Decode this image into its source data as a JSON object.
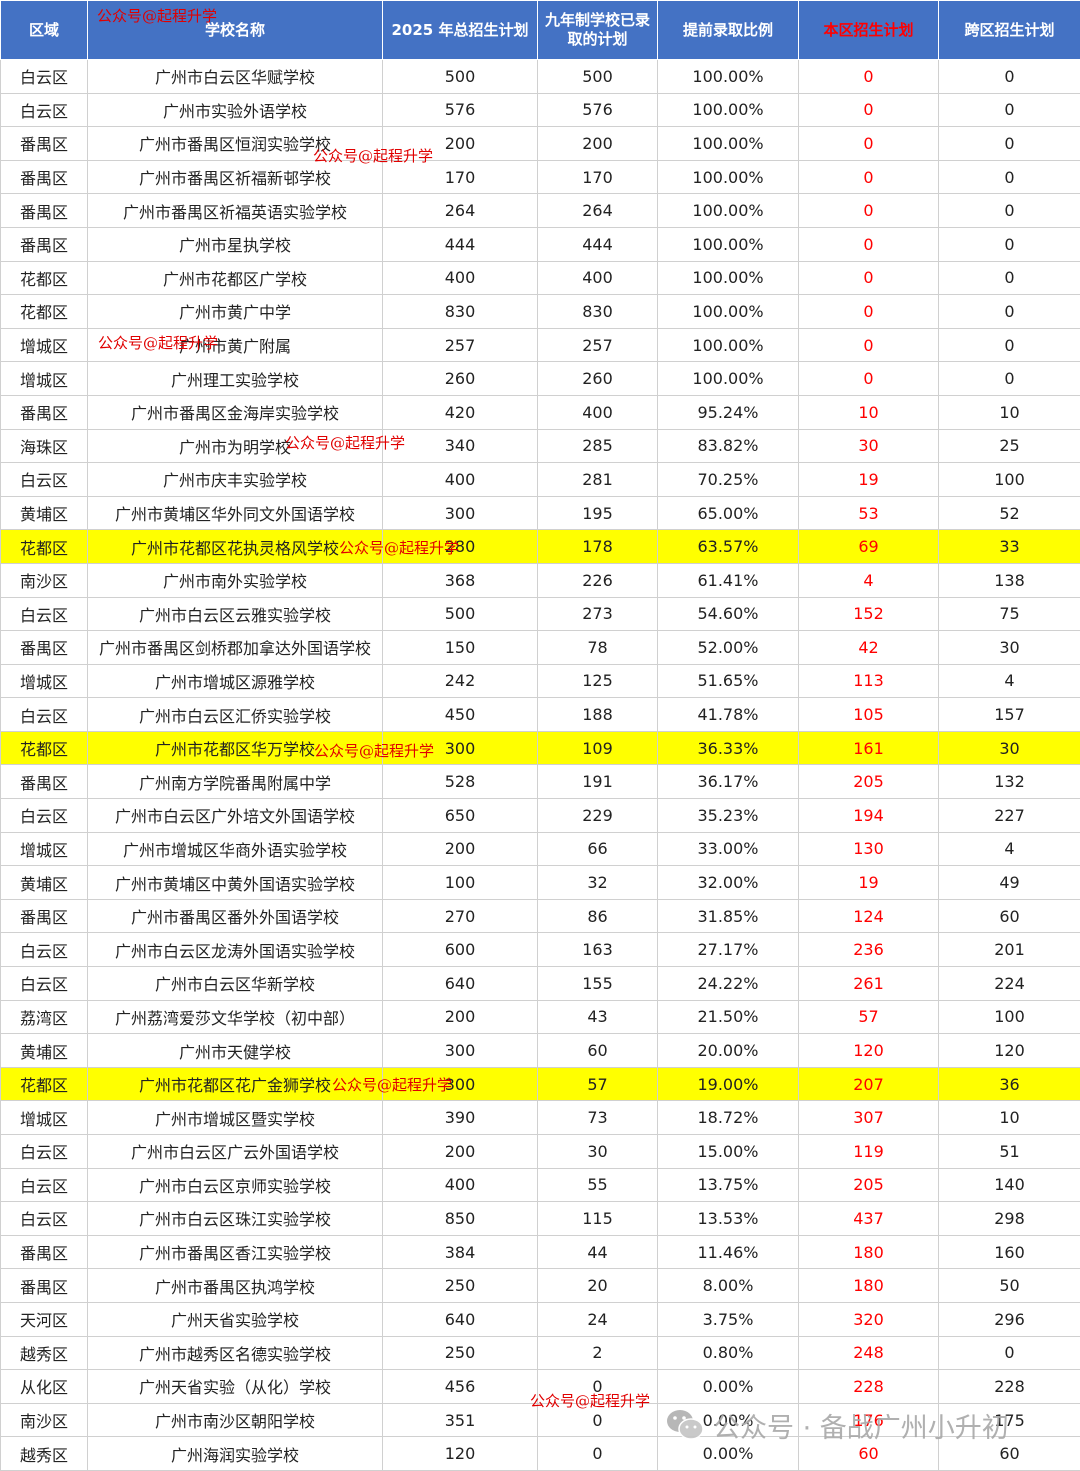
{
  "table": {
    "headers": [
      "区域",
      "学校名称",
      "2025 年总招生计划",
      "九年制学校已录取的计划",
      "提前录取比例",
      "本区招生计划",
      "跨区招生计划"
    ],
    "rows": [
      [
        "白云区",
        "广州市白云区华赋学校",
        "500",
        "500",
        "100.00%",
        "0",
        "0"
      ],
      [
        "白云区",
        "广州市实验外语学校",
        "576",
        "576",
        "100.00%",
        "0",
        "0"
      ],
      [
        "番禺区",
        "广州市番禺区恒润实验学校",
        "200",
        "200",
        "100.00%",
        "0",
        "0"
      ],
      [
        "番禺区",
        "广州市番禺区祈福新邨学校",
        "170",
        "170",
        "100.00%",
        "0",
        "0"
      ],
      [
        "番禺区",
        "广州市番禺区祈福英语实验学校",
        "264",
        "264",
        "100.00%",
        "0",
        "0"
      ],
      [
        "番禺区",
        "广州市星执学校",
        "444",
        "444",
        "100.00%",
        "0",
        "0"
      ],
      [
        "花都区",
        "广州市花都区广学校",
        "400",
        "400",
        "100.00%",
        "0",
        "0"
      ],
      [
        "花都区",
        "广州市黄广中学",
        "830",
        "830",
        "100.00%",
        "0",
        "0"
      ],
      [
        "增城区",
        "广州市黄广附属",
        "257",
        "257",
        "100.00%",
        "0",
        "0"
      ],
      [
        "增城区",
        "广州理工实验学校",
        "260",
        "260",
        "100.00%",
        "0",
        "0"
      ],
      [
        "番禺区",
        "广州市番禺区金海岸实验学校",
        "420",
        "400",
        "95.24%",
        "10",
        "10"
      ],
      [
        "海珠区",
        "广州市为明学校",
        "340",
        "285",
        "83.82%",
        "30",
        "25"
      ],
      [
        "白云区",
        "广州市庆丰实验学校",
        "400",
        "281",
        "70.25%",
        "19",
        "100"
      ],
      [
        "黄埔区",
        "广州市黄埔区华外同文外国语学校",
        "300",
        "195",
        "65.00%",
        "53",
        "52"
      ],
      [
        "花都区",
        "广州市花都区花执灵格风学校",
        "280",
        "178",
        "63.57%",
        "69",
        "33"
      ],
      [
        "南沙区",
        "广州市南外实验学校",
        "368",
        "226",
        "61.41%",
        "4",
        "138"
      ],
      [
        "白云区",
        "广州市白云区云雅实验学校",
        "500",
        "273",
        "54.60%",
        "152",
        "75"
      ],
      [
        "番禺区",
        "广州市番禺区剑桥郡加拿达外国语学校",
        "150",
        "78",
        "52.00%",
        "42",
        "30"
      ],
      [
        "增城区",
        "广州市增城区源雅学校",
        "242",
        "125",
        "51.65%",
        "113",
        "4"
      ],
      [
        "白云区",
        "广州市白云区汇侨实验学校",
        "450",
        "188",
        "41.78%",
        "105",
        "157"
      ],
      [
        "花都区",
        "广州市花都区华万学校",
        "300",
        "109",
        "36.33%",
        "161",
        "30"
      ],
      [
        "番禺区",
        "广州南方学院番禺附属中学",
        "528",
        "191",
        "36.17%",
        "205",
        "132"
      ],
      [
        "白云区",
        "广州市白云区广外培文外国语学校",
        "650",
        "229",
        "35.23%",
        "194",
        "227"
      ],
      [
        "增城区",
        "广州市增城区华商外语实验学校",
        "200",
        "66",
        "33.00%",
        "130",
        "4"
      ],
      [
        "黄埔区",
        "广州市黄埔区中黄外国语实验学校",
        "100",
        "32",
        "32.00%",
        "19",
        "49"
      ],
      [
        "番禺区",
        "广州市番禺区番外外国语学校",
        "270",
        "86",
        "31.85%",
        "124",
        "60"
      ],
      [
        "白云区",
        "广州市白云区龙涛外国语实验学校",
        "600",
        "163",
        "27.17%",
        "236",
        "201"
      ],
      [
        "白云区",
        "广州市白云区华新学校",
        "640",
        "155",
        "24.22%",
        "261",
        "224"
      ],
      [
        "荔湾区",
        "广州荔湾爱莎文华学校（初中部）",
        "200",
        "43",
        "21.50%",
        "57",
        "100"
      ],
      [
        "黄埔区",
        "广州市天健学校",
        "300",
        "60",
        "20.00%",
        "120",
        "120"
      ],
      [
        "花都区",
        "广州市花都区花广金狮学校",
        "300",
        "57",
        "19.00%",
        "207",
        "36"
      ],
      [
        "增城区",
        "广州市增城区暨实学校",
        "390",
        "73",
        "18.72%",
        "307",
        "10"
      ],
      [
        "白云区",
        "广州市白云区广云外国语学校",
        "200",
        "30",
        "15.00%",
        "119",
        "51"
      ],
      [
        "白云区",
        "广州市白云区京师实验学校",
        "400",
        "55",
        "13.75%",
        "205",
        "140"
      ],
      [
        "白云区",
        "广州市白云区珠江实验学校",
        "850",
        "115",
        "13.53%",
        "437",
        "298"
      ],
      [
        "番禺区",
        "广州市番禺区香江实验学校",
        "384",
        "44",
        "11.46%",
        "180",
        "160"
      ],
      [
        "番禺区",
        "广州市番禺区执鸿学校",
        "250",
        "20",
        "8.00%",
        "180",
        "50"
      ],
      [
        "天河区",
        "广州天省实验学校",
        "640",
        "24",
        "3.75%",
        "320",
        "296"
      ],
      [
        "越秀区",
        "广州市越秀区名德实验学校",
        "250",
        "2",
        "0.80%",
        "248",
        "0"
      ],
      [
        "从化区",
        "广州天省实验（从化）学校",
        "456",
        "0",
        "0.00%",
        "228",
        "228"
      ],
      [
        "南沙区",
        "广州市南沙区朝阳学校",
        "351",
        "0",
        "0.00%",
        "176",
        "175"
      ],
      [
        "越秀区",
        "广州海润实验学校",
        "120",
        "0",
        "0.00%",
        "60",
        "60"
      ]
    ],
    "highlighted_rows": [
      14,
      20,
      30
    ],
    "highlight_color": "#ffff00",
    "header_bg": "#4472c4",
    "emphasis_color": "#ff0000"
  },
  "watermarks": {
    "label": "公众号@起程升学",
    "count": 9
  },
  "brand": {
    "icon": "wechat-logo-icon",
    "text": "公众号 · 备战广州小升初"
  }
}
